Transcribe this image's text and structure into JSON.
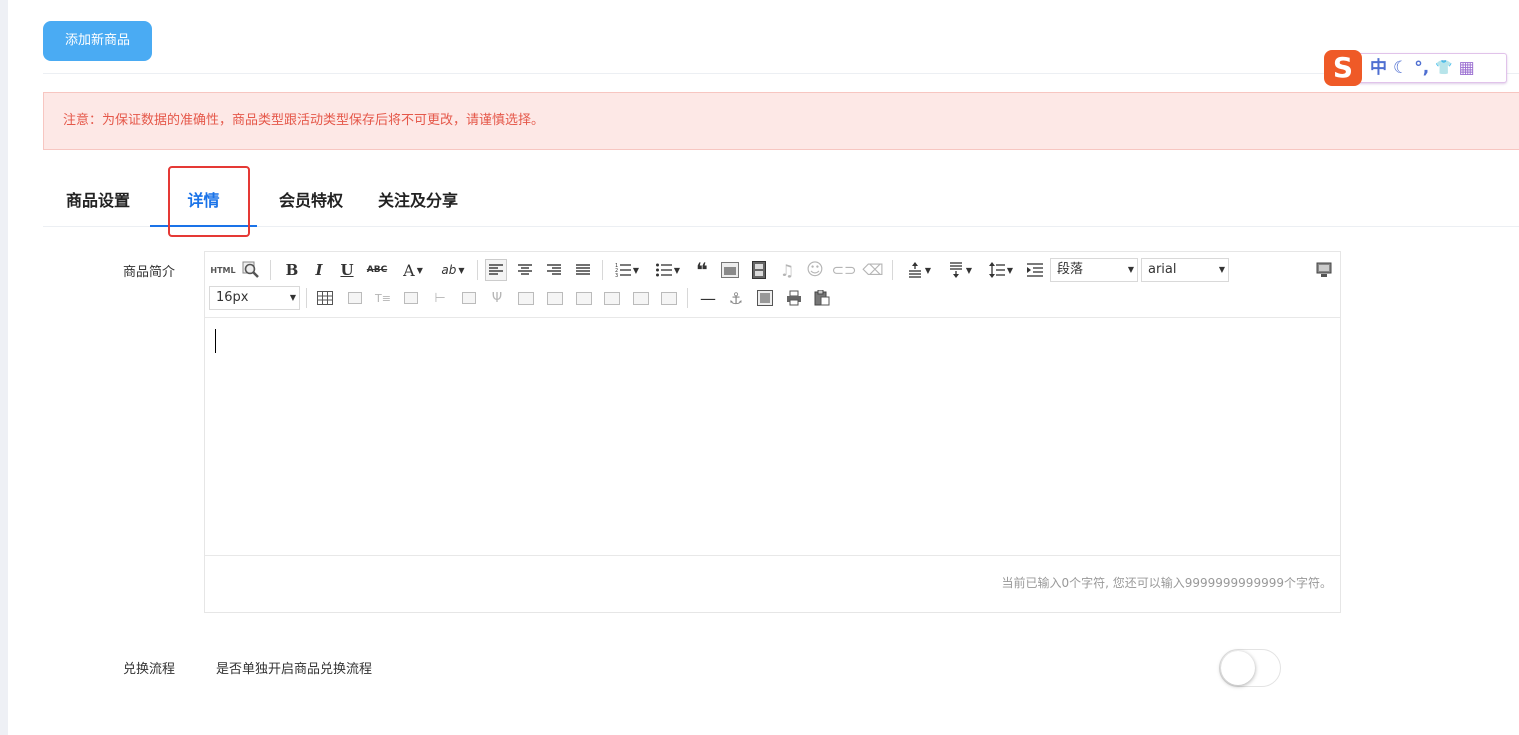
{
  "header": {
    "add_button_label": "添加新商品"
  },
  "notice": {
    "text": "注意：为保证数据的准确性，商品类型跟活动类型保存后将不可更改，请谨慎选择。"
  },
  "ime_bar": {
    "logo": "S",
    "mode": "中",
    "glyphs": [
      "☾",
      "°,",
      "👕",
      "▦"
    ]
  },
  "tabs": [
    {
      "label": "商品设置"
    },
    {
      "label": "详情",
      "active": true
    },
    {
      "label": "会员特权"
    },
    {
      "label": "关注及分享"
    }
  ],
  "intro": {
    "label": "商品简介",
    "toolbar": {
      "html_label": "HTML",
      "bold": "B",
      "italic": "I",
      "underline": "U",
      "strike": "ABC",
      "font_color": "A",
      "back_color": "ab",
      "quote": "❝",
      "paragraph_select": "段落",
      "font_family_select": "arial",
      "font_size_select": "16px",
      "hr": "—",
      "anchor": "⚓"
    },
    "counter_text": "当前已输入0个字符, 您还可以输入9999999999999个字符。"
  },
  "exchange": {
    "label": "兑换流程",
    "description": "是否单独开启商品兑换流程",
    "enabled": false
  },
  "colors": {
    "primary": "#4aabf3",
    "active_tab": "#1a73e8",
    "alert_bg": "#fde8e6",
    "alert_text": "#e5584a",
    "highlight": "#e53935"
  }
}
